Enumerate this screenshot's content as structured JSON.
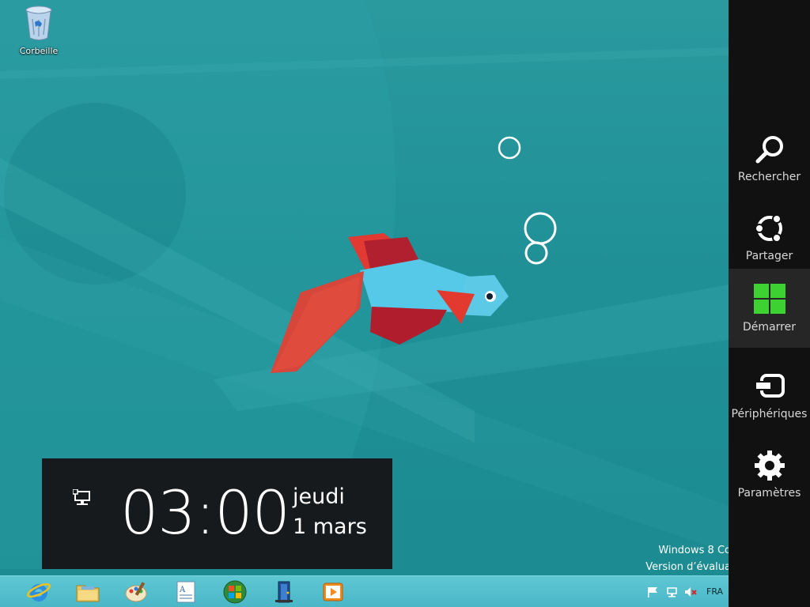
{
  "desktop": {
    "icons": [
      {
        "label": "Corbeille",
        "icon": "recycle-bin-icon"
      }
    ],
    "watermark": {
      "line1": "Windows 8 Co",
      "line2": "Version d’évalua"
    }
  },
  "clock": {
    "time": "03:00",
    "day": "jeudi",
    "date": "1 mars",
    "network_icon": "network-icon"
  },
  "charms": [
    {
      "label": "Rechercher",
      "icon": "search-icon"
    },
    {
      "label": "Partager",
      "icon": "share-icon"
    },
    {
      "label": "Démarrer",
      "icon": "windows-logo-icon"
    },
    {
      "label": "Périphériques",
      "icon": "devices-icon"
    },
    {
      "label": "Paramètres",
      "icon": "gear-icon"
    }
  ],
  "taskbar": {
    "apps": [
      {
        "name": "Internet Explorer",
        "icon": "ie-icon"
      },
      {
        "name": "File Explorer",
        "icon": "folder-icon"
      },
      {
        "name": "Paint",
        "icon": "paint-icon"
      },
      {
        "name": "WordPad",
        "icon": "wordpad-icon"
      },
      {
        "name": "Windows Media Center",
        "icon": "media-center-icon"
      },
      {
        "name": "Application",
        "icon": "door-icon"
      },
      {
        "name": "Windows Media Player",
        "icon": "media-player-icon"
      }
    ],
    "tray": {
      "language": "FRA",
      "icons": [
        "flag-icon",
        "network-icon",
        "volume-muted-icon"
      ]
    }
  },
  "colors": {
    "charms_bg": "#111111",
    "start_green": "#3dd131",
    "wallpaper_teal": "#1f9096"
  }
}
